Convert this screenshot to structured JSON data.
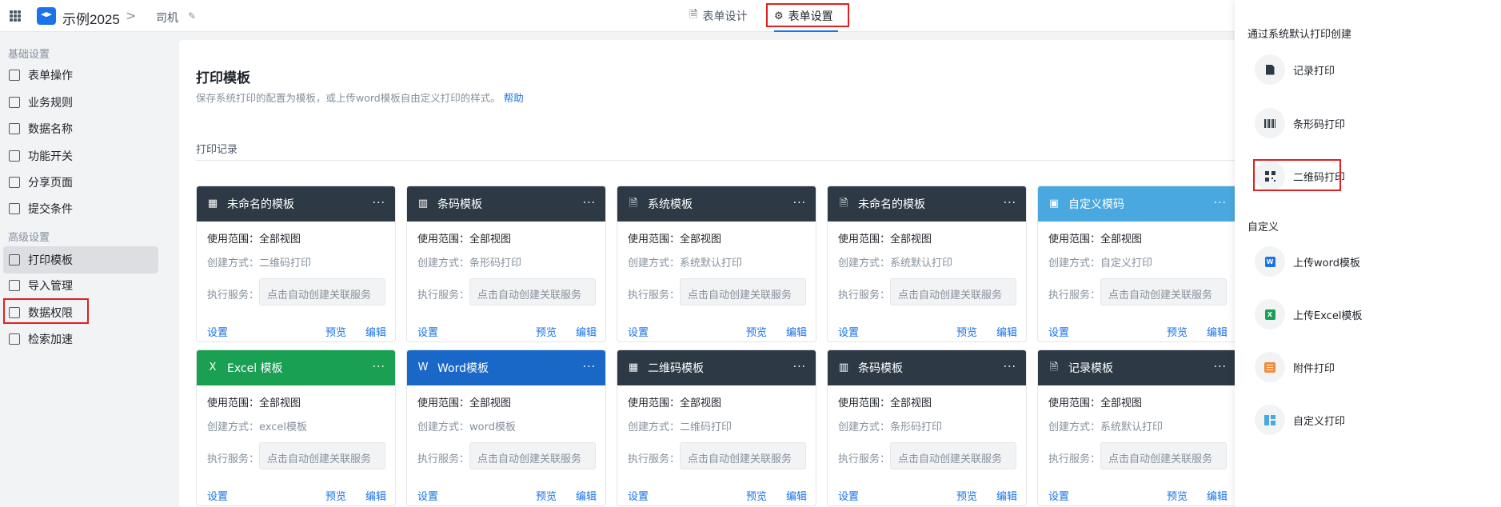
{
  "topbar": {
    "app_name": "示例2025",
    "crumb_sep": ">",
    "crumb": "司机",
    "tabs": [
      {
        "label": "表单设计",
        "icon": "document-icon"
      },
      {
        "label": "表单设置",
        "icon": "gear-icon"
      }
    ]
  },
  "sidebar": {
    "section_basic": "基础设置",
    "section_advanced": "高级设置",
    "items": [
      {
        "label": "表单操作",
        "icon": "form-icon"
      },
      {
        "label": "业务规则",
        "icon": "rules-icon"
      },
      {
        "label": "数据名称",
        "icon": "data-name-icon"
      },
      {
        "label": "功能开关",
        "icon": "toggle-icon"
      },
      {
        "label": "分享页面",
        "icon": "share-icon"
      },
      {
        "label": "提交条件",
        "icon": "submit-icon"
      },
      {
        "label": "打印模板",
        "icon": "printer-icon"
      },
      {
        "label": "导入管理",
        "icon": "import-icon"
      },
      {
        "label": "数据权限",
        "icon": "shield-icon"
      },
      {
        "label": "检索加速",
        "icon": "speed-icon"
      }
    ]
  },
  "main": {
    "title": "打印模板",
    "desc": "保存系统打印的配置为模板，或上传word模板自由定义打印的样式。",
    "help": "帮助",
    "section": "打印记录",
    "scope_label": "使用范围：",
    "method_label": "创建方式：",
    "service_label": "执行服务：",
    "service_placeholder": "点击自动创建关联服务",
    "foot_set": "设置",
    "foot_preview": "预览",
    "foot_edit": "编辑",
    "more": "···",
    "cards": [
      {
        "title": "未命名的模板",
        "scope": "全部视图",
        "method": "二维码打印",
        "icon": "qr-icon",
        "color": "#2d3a46"
      },
      {
        "title": "条码模板",
        "scope": "全部视图",
        "method": "条形码打印",
        "icon": "barcode-icon",
        "color": "#2d3a46"
      },
      {
        "title": "系统模板",
        "scope": "全部视图",
        "method": "系统默认打印",
        "icon": "document-icon",
        "color": "#2d3a46"
      },
      {
        "title": "未命名的模板",
        "scope": "全部视图",
        "method": "系统默认打印",
        "icon": "document-icon",
        "color": "#2d3a46"
      },
      {
        "title": "自定义模码",
        "scope": "全部视图",
        "method": "自定义打印",
        "icon": "custom-icon",
        "color": "#4aa8e0"
      },
      {
        "title": "Excel 模板",
        "scope": "全部视图",
        "method": "excel模板",
        "icon": "excel-icon",
        "color": "#1aa052"
      },
      {
        "title": "Word模板",
        "scope": "全部视图",
        "method": "word模板",
        "icon": "word-icon",
        "color": "#1968c8"
      },
      {
        "title": "二维码模板",
        "scope": "全部视图",
        "method": "二维码打印",
        "icon": "qr-icon",
        "color": "#2d3a46"
      },
      {
        "title": "条码模板",
        "scope": "全部视图",
        "method": "条形码打印",
        "icon": "barcode-icon",
        "color": "#2d3a46"
      },
      {
        "title": "记录模板",
        "scope": "全部视图",
        "method": "系统默认打印",
        "icon": "document-icon",
        "color": "#2d3a46"
      }
    ]
  },
  "drawer": {
    "group_default": "通过系统默认打印创建",
    "group_custom": "自定义",
    "options": [
      {
        "label": "记录打印",
        "icon": "document-icon"
      },
      {
        "label": "条形码打印",
        "icon": "barcode-icon"
      },
      {
        "label": "二维码打印",
        "icon": "qr-icon"
      },
      {
        "label": "上传word模板",
        "icon": "word-icon"
      },
      {
        "label": "上传Excel模板",
        "icon": "excel-icon"
      },
      {
        "label": "附件打印",
        "icon": "attachment-icon"
      },
      {
        "label": "自定义打印",
        "icon": "custom-layout-icon"
      }
    ]
  }
}
